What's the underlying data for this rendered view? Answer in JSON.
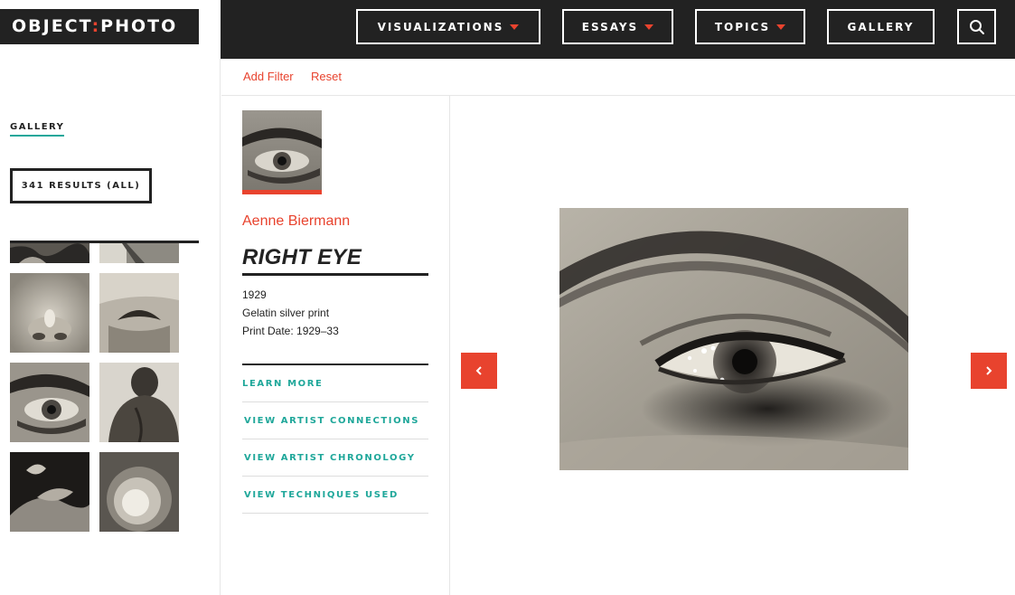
{
  "header": {
    "logo_left": "OBJECT",
    "logo_sep": ":",
    "logo_right": "PHOTO",
    "nav": [
      {
        "label": "VISUALIZATIONS",
        "dropdown": true
      },
      {
        "label": "ESSAYS",
        "dropdown": true
      },
      {
        "label": "TOPICS",
        "dropdown": true
      },
      {
        "label": "GALLERY",
        "dropdown": false
      }
    ],
    "search_icon": "search-icon"
  },
  "filters": {
    "add_label": "Add Filter",
    "reset_label": "Reset"
  },
  "sidebar": {
    "section_label": "GALLERY",
    "results_label": "341 RESULTS (ALL)"
  },
  "artwork": {
    "artist": "Aenne Biermann",
    "title": "RIGHT EYE",
    "year": "1929",
    "medium": "Gelatin silver print",
    "print_date": "Print Date: 1929–33"
  },
  "links": [
    {
      "label": "LEARN MORE"
    },
    {
      "label": "VIEW ARTIST CONNECTIONS"
    },
    {
      "label": "VIEW ARTIST CHRONOLOGY"
    },
    {
      "label": "VIEW TECHNIQUES USED"
    }
  ],
  "colors": {
    "accent": "#e8432e",
    "teal": "#1fa79a",
    "dark": "#222222"
  },
  "icons": {
    "prev": "chevron-left-icon",
    "next": "chevron-right-icon"
  }
}
